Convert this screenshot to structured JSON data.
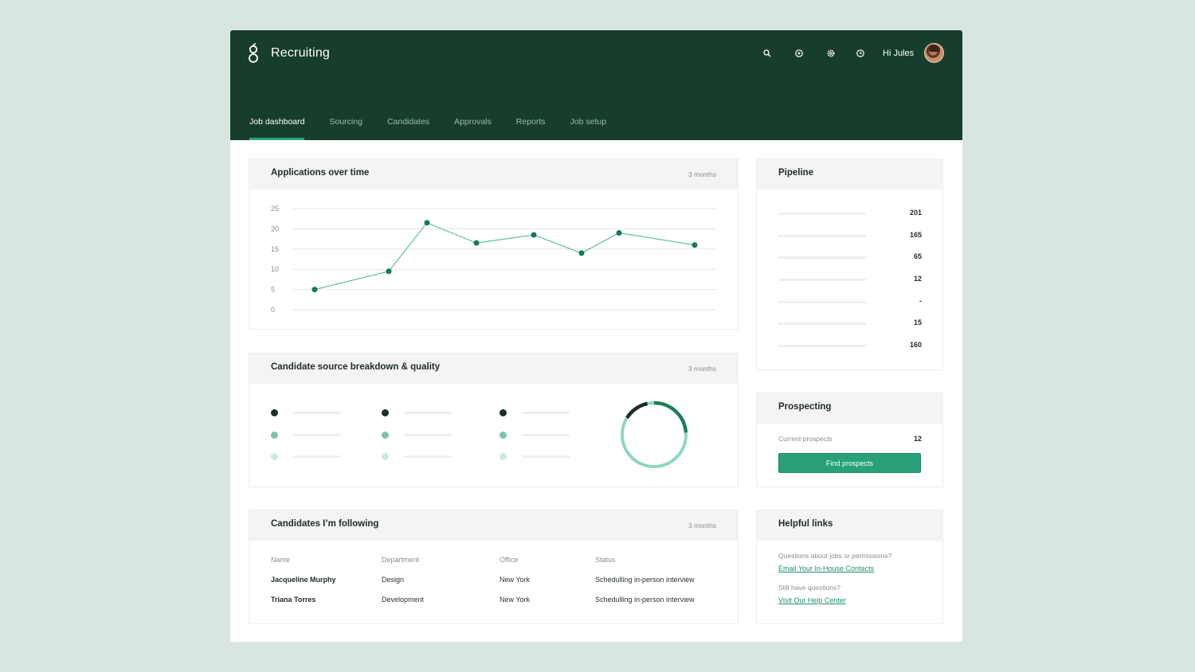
{
  "app": {
    "title": "Recruiting",
    "greeting": "Hi Jules"
  },
  "header_icons": [
    "search-icon",
    "target-icon",
    "gear-icon",
    "clock-icon"
  ],
  "tabs": [
    {
      "label": "Job dashboard",
      "active": true
    },
    {
      "label": "Sourcing",
      "active": false
    },
    {
      "label": "Candidates",
      "active": false
    },
    {
      "label": "Approvals",
      "active": false
    },
    {
      "label": "Reports",
      "active": false
    },
    {
      "label": "Job setup",
      "active": false
    }
  ],
  "applications": {
    "title": "Applications over time",
    "range": "3 months"
  },
  "chart_data": {
    "type": "line",
    "title": "Applications over time",
    "y_ticks": [
      25,
      20,
      15,
      10,
      5,
      0
    ],
    "ylim": [
      0,
      25
    ],
    "values": [
      5,
      9.5,
      21.5,
      16.5,
      18.5,
      14,
      19,
      16
    ],
    "grid": true,
    "line_color": "#6cc3a4",
    "point_color": "#167a52"
  },
  "pipeline": {
    "title": "Pipeline",
    "values": [
      "201",
      "165",
      "65",
      "12",
      "-",
      "15",
      "160"
    ]
  },
  "source": {
    "title": "Candidate source breakdown & quality",
    "range": "3 months",
    "dot_colors": [
      "#1b2f27",
      "#7cc5a9",
      "#c8ebdf"
    ],
    "donut_colors": [
      "#1b2f27",
      "#1e7e57",
      "#8dd6bf"
    ]
  },
  "prospecting": {
    "title": "Prospecting",
    "label": "Current prospects",
    "value": "12",
    "button": "Find prospects"
  },
  "following": {
    "title": "Candidates I’m following",
    "range": "3 months",
    "columns": [
      "Name",
      "Department",
      "Office",
      "Status"
    ],
    "rows": [
      {
        "name": "Jacqueline Murphy",
        "department": "Design",
        "office": "New York",
        "status": "Schedulling in-person interview"
      },
      {
        "name": "Triana Torres",
        "department": "Development",
        "office": "New York",
        "status": "Schedulling in-person interview"
      }
    ]
  },
  "helpful": {
    "title": "Helpful links",
    "q1": "Questions about jobs or permissions?",
    "link1": "Email Your In-House Contacts",
    "q2": "Still have questions?",
    "link2": "Visit Our Help Center"
  }
}
